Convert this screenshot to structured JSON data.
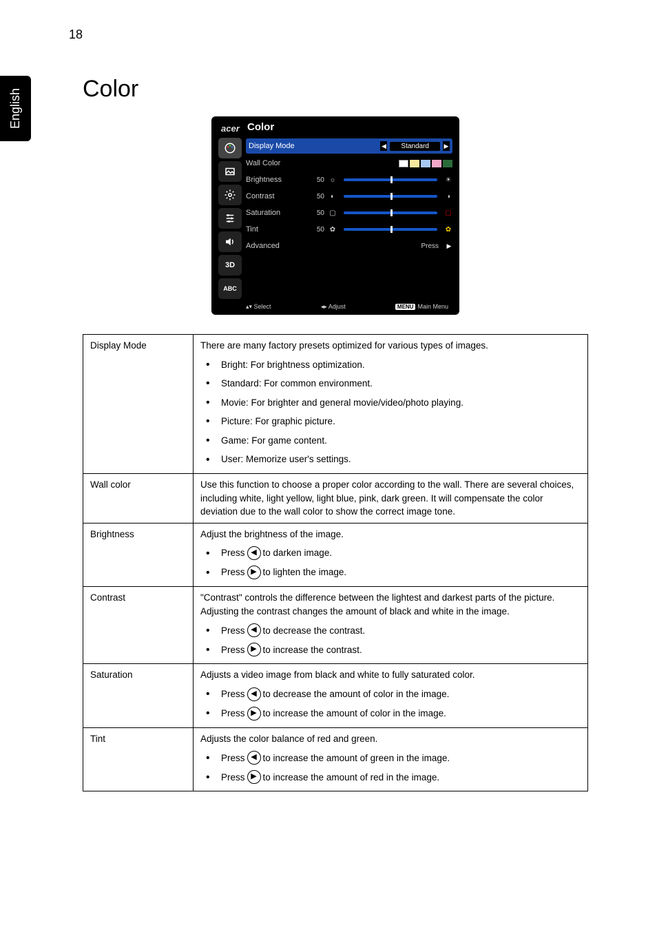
{
  "page": {
    "number": "18",
    "language": "English"
  },
  "section": {
    "title": "Color"
  },
  "osd": {
    "logo": "acer",
    "title": "Color",
    "rows": {
      "display_mode": {
        "label": "Display Mode",
        "value": "Standard"
      },
      "wall_color": {
        "label": "Wall Color"
      },
      "brightness": {
        "label": "Brightness",
        "num": "50"
      },
      "contrast": {
        "label": "Contrast",
        "num": "50"
      },
      "saturation": {
        "label": "Saturation",
        "num": "50"
      },
      "tint": {
        "label": "Tint",
        "num": "50"
      },
      "advanced": {
        "label": "Advanced",
        "action": "Press"
      }
    },
    "footer": {
      "select": "Select",
      "adjust": "Adjust",
      "menu_badge": "MENU",
      "menu": "Main Menu"
    }
  },
  "table": {
    "display_mode": {
      "name": "Display Mode",
      "intro": "There are many factory presets optimized for various types of images.",
      "items": {
        "bright": "Bright: For brightness optimization.",
        "standard": "Standard: For common environment.",
        "movie": "Movie: For brighter and general movie/video/photo playing.",
        "picture": "Picture: For graphic picture.",
        "game": "Game: For game content.",
        "user": "User: Memorize user's settings."
      }
    },
    "wall_color": {
      "name": "Wall color",
      "desc": "Use this function to choose a proper color according to the wall. There are several choices, including white, light yellow, light blue, pink, dark green. It will compensate the color deviation due to the wall color to show the correct image tone."
    },
    "brightness": {
      "name": "Brightness",
      "intro": "Adjust the brightness of the image.",
      "left_pre": "Press ",
      "left_post": " to darken image.",
      "right_pre": "Press ",
      "right_post": " to lighten the image."
    },
    "contrast": {
      "name": "Contrast",
      "intro": "\"Contrast\" controls the difference between the lightest and darkest parts of the picture. Adjusting the contrast changes the amount of black and white in the image.",
      "left_pre": "Press ",
      "left_post": " to decrease the contrast.",
      "right_pre": "Press ",
      "right_post": " to increase the contrast."
    },
    "saturation": {
      "name": "Saturation",
      "intro": "Adjusts a video image from black and white to fully saturated color.",
      "left_pre": "Press ",
      "left_post": " to decrease the amount of color in the image.",
      "right_pre": "Press ",
      "right_post": " to increase the amount of color in the image."
    },
    "tint": {
      "name": "Tint",
      "intro": "Adjusts the color balance of red and green.",
      "left_pre": "Press ",
      "left_post": " to increase the amount of green in the image.",
      "right_pre": "Press ",
      "right_post": " to increase the amount of red in the image."
    }
  }
}
